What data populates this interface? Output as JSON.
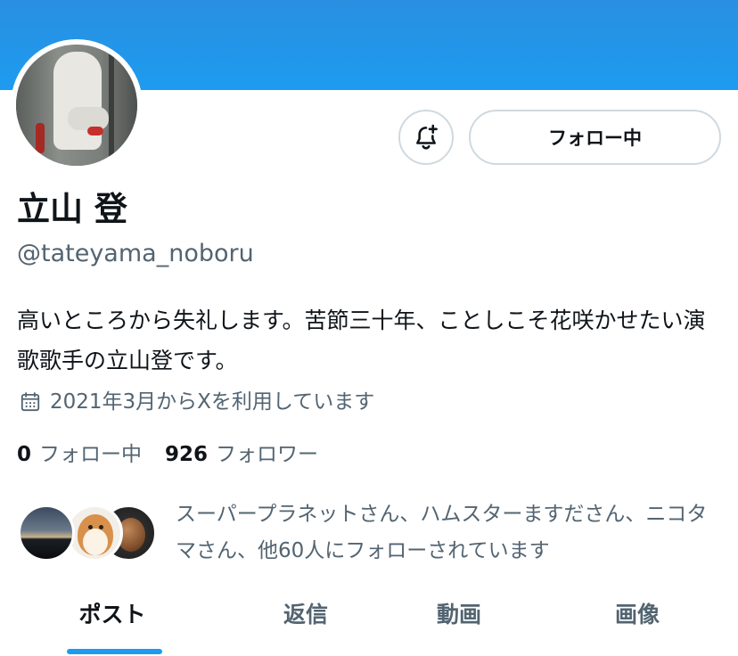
{
  "profile": {
    "name": "立山 登",
    "handle": "@tateyama_noboru",
    "bio": "高いところから失礼します。苦節三十年、ことしこそ花咲かせたい演歌歌手の立山登です。",
    "joined": "2021年3月からXを利用しています"
  },
  "actions": {
    "follow_label": "フォロー中",
    "notify_icon": "bell-plus-icon"
  },
  "stats": {
    "following_count": "0",
    "following_label": "フォロー中",
    "followers_count": "926",
    "followers_label": "フォロワー"
  },
  "followed_by": {
    "text": "スーパープラネットさん、ハムスターますださん、ニコタマさん、他60人にフォローされています"
  },
  "tabs": [
    {
      "label": "ポスト",
      "active": true
    },
    {
      "label": "返信",
      "active": false
    },
    {
      "label": "動画",
      "active": false
    },
    {
      "label": "画像",
      "active": false
    }
  ],
  "colors": {
    "accent": "#1d9bf0",
    "text_primary": "#0f1419",
    "text_secondary": "#536471",
    "border": "#cfd9de"
  }
}
